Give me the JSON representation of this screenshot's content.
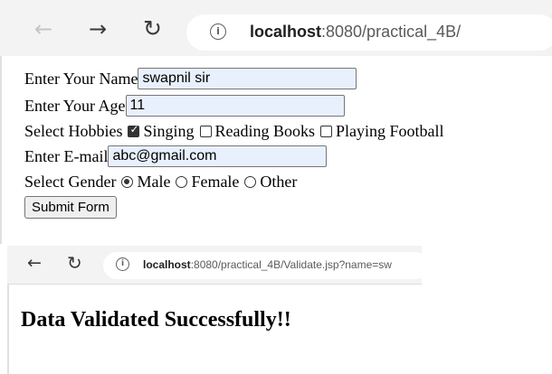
{
  "browser_top": {
    "back_icon": "←",
    "forward_icon": "→",
    "reload_icon": "↻",
    "info_icon": "i",
    "url_host": "localhost",
    "url_path": ":8080/practical_4B/"
  },
  "form": {
    "name_label": "Enter Your Name",
    "name_value": "swapnil sir",
    "age_label": "Enter Your Age",
    "age_value": "11",
    "hobbies_label": "Select Hobbies",
    "hobbies": [
      {
        "label": "Singing",
        "checked": true
      },
      {
        "label": "Reading Books",
        "checked": false
      },
      {
        "label": "Playing Football",
        "checked": false
      }
    ],
    "email_label": "Enter E-mail",
    "email_value": "abc@gmail.com",
    "gender_label": "Select Gender",
    "genders": [
      {
        "label": "Male",
        "checked": true
      },
      {
        "label": "Female",
        "checked": false
      },
      {
        "label": "Other",
        "checked": false
      }
    ],
    "submit_label": "Submit Form"
  },
  "browser_second": {
    "back_icon": "←",
    "reload_icon": "↻",
    "info_icon": "i",
    "url_host": "localhost",
    "url_path": ":8080/practical_4B/Validate.jsp?name=sw"
  },
  "result": {
    "heading": "Data Validated Successfully!!"
  }
}
